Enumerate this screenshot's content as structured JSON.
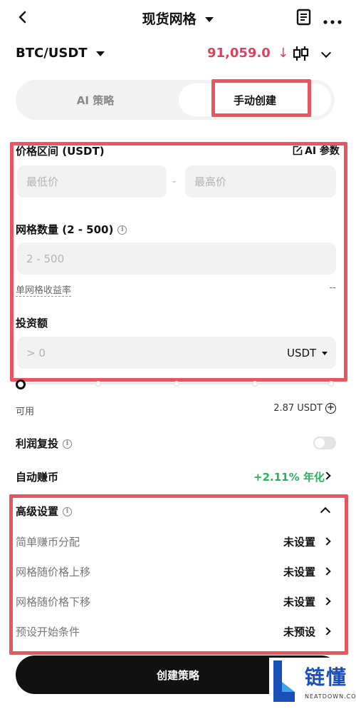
{
  "colors": {
    "accent_red": "#e8575f",
    "price_red": "#e0405e",
    "green": "#2bb35a"
  },
  "header": {
    "back_icon": "chevron-left",
    "title": "现货网格",
    "menu_icon": "document-icon",
    "more_icon": "more-dots"
  },
  "pair": {
    "symbol": "BTC/USDT",
    "price": "91,059.0",
    "trend_arrow": "↓"
  },
  "tabs": [
    {
      "label": "AI 策略",
      "selected": false
    },
    {
      "label": "手动创建",
      "selected": true
    }
  ],
  "price_range": {
    "label": "价格区间 (USDT)",
    "ai_params": "AI 参数",
    "min_placeholder": "最低价",
    "separator": "-",
    "max_placeholder": "最高价"
  },
  "grid_count": {
    "label": "网格数量 (2 - 500)",
    "placeholder": "2 - 500",
    "yield_label": "单网格收益率",
    "yield_value": "--"
  },
  "investment": {
    "label": "投资额",
    "placeholder": "> 0",
    "currency": "USDT"
  },
  "available": {
    "label": "可用",
    "value": "2.87 USDT"
  },
  "profit_reinvest": {
    "label": "利润复投",
    "enabled": false
  },
  "auto_earn": {
    "label": "自动赚币",
    "value": "+2.11% 年化"
  },
  "advanced": {
    "label": "高级设置",
    "items": [
      {
        "label": "简单赚币分配",
        "value": "未设置"
      },
      {
        "label": "网格随价格上移",
        "value": "未设置"
      },
      {
        "label": "网格随价格下移",
        "value": "未设置"
      },
      {
        "label": "预设开始条件",
        "value": "未预设"
      }
    ]
  },
  "create_button": "创建策略",
  "watermark": {
    "brand": "链懂",
    "site": "NEATDOWN.COM"
  }
}
